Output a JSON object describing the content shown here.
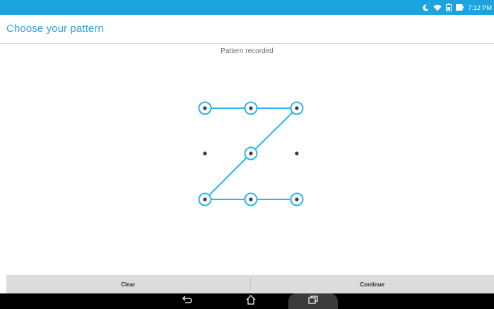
{
  "status_bar": {
    "time": "7:12 PM",
    "icons": [
      "moon-icon",
      "wifi-icon",
      "battery-saver-icon",
      "battery-icon"
    ]
  },
  "app_bar": {
    "title": "Choose your pattern"
  },
  "header_message": "Pattern recorded",
  "pattern": {
    "grid": 3,
    "selected_sequence": [
      1,
      2,
      3,
      5,
      7,
      8,
      9
    ],
    "accent_color": "#29b6e8",
    "dot_color": "#3a3f44"
  },
  "buttons": {
    "clear_label": "Clear",
    "continue_label": "Continue"
  },
  "nav_bar": {
    "items": [
      "back-icon",
      "home-icon",
      "recent-apps-icon"
    ]
  }
}
